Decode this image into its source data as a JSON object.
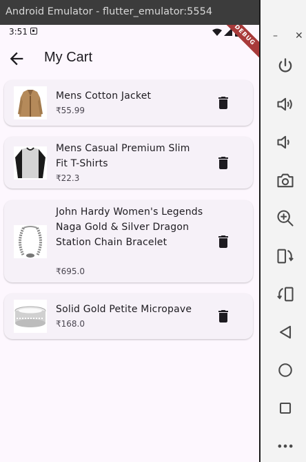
{
  "window": {
    "title": "Android Emulator - flutter_emulator:5554"
  },
  "status_bar": {
    "time": "3:51",
    "debug_banner": "DEBUG"
  },
  "app_bar": {
    "title": "My Cart"
  },
  "cart": {
    "items": [
      {
        "name": "Mens Cotton Jacket",
        "price": "₹55.99"
      },
      {
        "name": "Mens Casual Premium Slim Fit T-Shirts",
        "price": "₹22.3"
      },
      {
        "name": "John Hardy Women's Legends Naga Gold & Silver Dragon Station Chain Bracelet",
        "price": "₹695.0"
      },
      {
        "name": "Solid Gold Petite Micropave",
        "price": "₹168.0"
      }
    ]
  },
  "emulator_toolbar": {
    "minimize_label": "–",
    "close_label": "✕",
    "buttons": [
      "power-icon",
      "volume-up-icon",
      "volume-down-icon",
      "camera-icon",
      "zoom-icon",
      "rotate-left-icon",
      "rotate-right-icon",
      "back-icon",
      "home-icon",
      "overview-icon",
      "more-icon"
    ]
  },
  "colors": {
    "screen_bg": "#fdf7fe",
    "card_bg": "#f6f1f8",
    "debug_ribbon": "#a83a3a",
    "text": "#1d1b20"
  }
}
